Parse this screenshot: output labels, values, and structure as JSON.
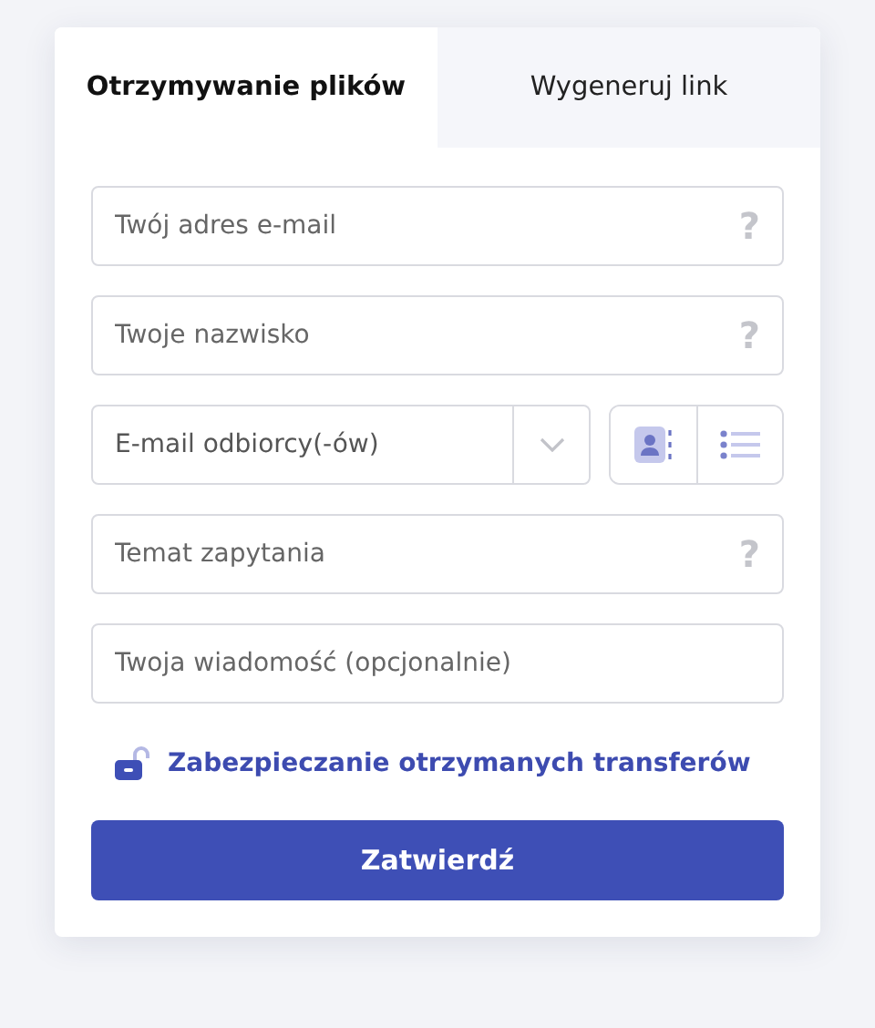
{
  "tabs": [
    {
      "label": "Otrzymywanie plików",
      "selected": true
    },
    {
      "label": "Wygeneruj link",
      "selected": false
    }
  ],
  "fields": [
    {
      "kind": "help",
      "placeholder": "Twój adres e-mail",
      "help": "?"
    },
    {
      "kind": "help",
      "placeholder": "Twoje nazwisko",
      "help": "?"
    },
    {
      "kind": "recipients",
      "placeholder": "E-mail odbiorcy(-ów)"
    },
    {
      "kind": "help",
      "placeholder": "Temat zapytania",
      "help": "?"
    },
    {
      "kind": "plain",
      "placeholder": "Twoja wiadomość (opcjonalnie)"
    }
  ],
  "security_link": "Zabezpieczanie otrzymanych transferów",
  "submit_button": "Zatwierdź"
}
